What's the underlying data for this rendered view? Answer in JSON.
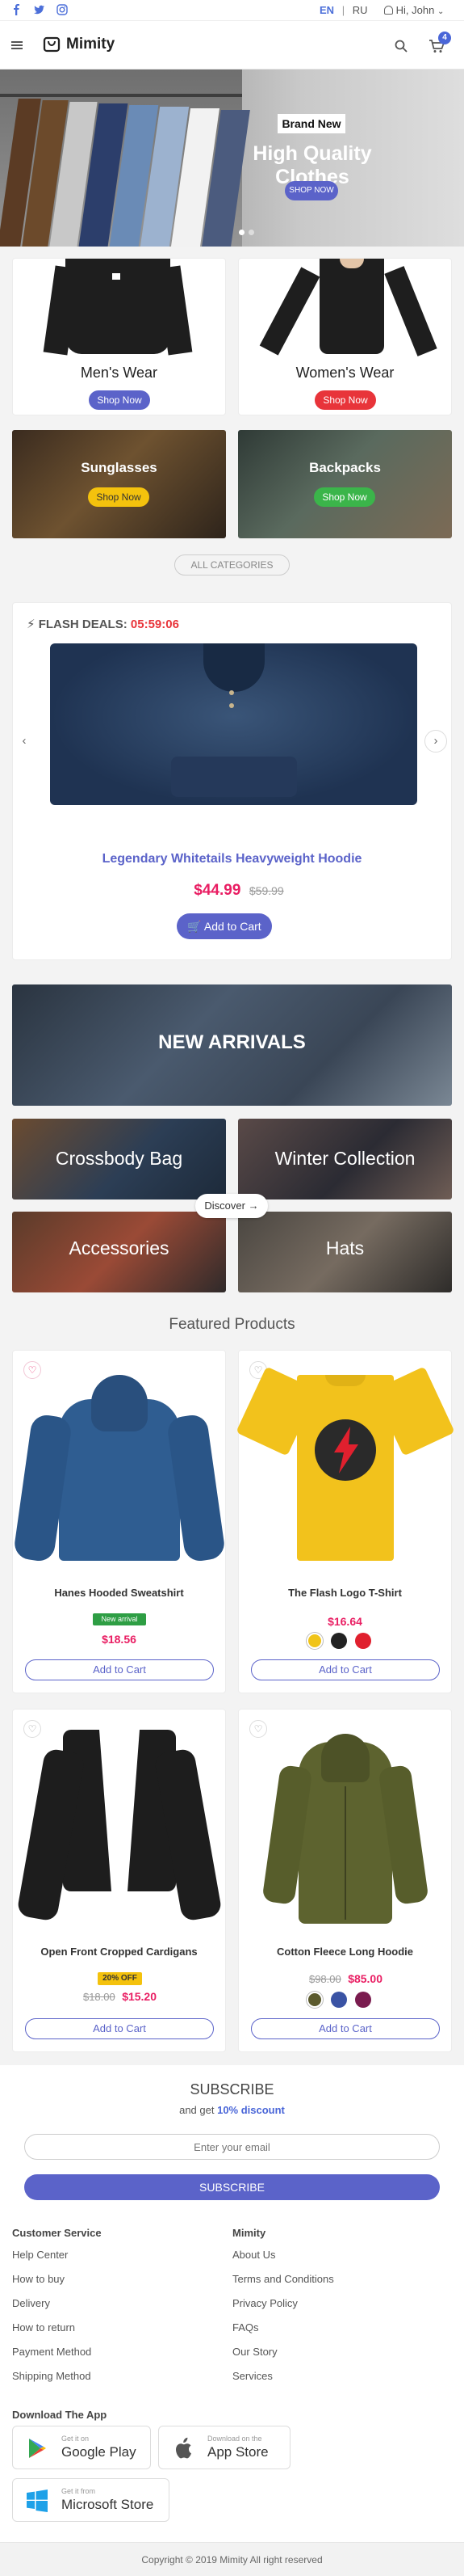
{
  "topbar": {
    "social": [
      "facebook-icon",
      "twitter-icon",
      "instagram-icon"
    ],
    "lang_en": "EN",
    "lang_sep": "|",
    "lang_ru": "RU",
    "greeting": "Hi, John"
  },
  "header": {
    "brand": "Mimity",
    "cart_count": "4"
  },
  "hero": {
    "tag": "Brand New",
    "title": "High Quality Clothes",
    "button": "SHOP NOW"
  },
  "categories": [
    {
      "title": "Men's Wear",
      "button": "Shop Now"
    },
    {
      "title": "Women's Wear",
      "button": "Shop Now"
    },
    {
      "title": "Sunglasses",
      "button": "Shop Now"
    },
    {
      "title": "Backpacks",
      "button": "Shop Now"
    }
  ],
  "all_categories": "ALL CATEGORIES",
  "flash": {
    "label": "FLASH DEALS:",
    "timer": "05:59:06",
    "product": "Legendary Whitetails Heavyweight Hoodie",
    "price": "$44.99",
    "old_price": "$59.99",
    "button": "Add to Cart"
  },
  "collections": {
    "banner": "NEW ARRIVALS",
    "tiles": [
      "Crossbody Bag",
      "Winter Collection",
      "Accessories",
      "Hats"
    ],
    "discover": "Discover"
  },
  "featured": {
    "heading": "Featured Products",
    "products": [
      {
        "name": "Hanes Hooded Sweatshirt",
        "badge": "New arrival",
        "price": "$18.56",
        "old_price": "",
        "button": "Add to Cart",
        "swatches": []
      },
      {
        "name": "The Flash Logo T-Shirt",
        "badge": "",
        "price": "$16.64",
        "old_price": "",
        "button": "Add to Cart",
        "swatches": [
          "#f0c419",
          "#222222",
          "#e0202e"
        ]
      },
      {
        "name": "Open Front Cropped Cardigans",
        "badge": "20% OFF",
        "price": "$15.20",
        "old_price": "$18.00",
        "button": "Add to Cart",
        "swatches": []
      },
      {
        "name": "Cotton Fleece Long Hoodie",
        "badge": "",
        "price": "$85.00",
        "old_price": "$98.00",
        "button": "Add to Cart",
        "swatches": [
          "#5b5a2d",
          "#3a53a4",
          "#7a1c4f"
        ]
      }
    ]
  },
  "subscribe": {
    "title": "SUBSCRIBE",
    "sub_a": "and get",
    "sub_b": "10% discount",
    "placeholder": "Enter your email",
    "button": "SUBSCRIBE"
  },
  "footer": {
    "col1_title": "Customer Service",
    "col1": [
      "Help Center",
      "How to buy",
      "Delivery",
      "How to return",
      "Payment Method",
      "Shipping Method"
    ],
    "col2_title": "Mimity",
    "col2": [
      "About Us",
      "Terms and Conditions",
      "Privacy Policy",
      "FAQs",
      "Our Story",
      "Services"
    ],
    "app_title": "Download The App",
    "stores": [
      {
        "small": "Get it on",
        "big": "Google Play"
      },
      {
        "small": "Download on the",
        "big": "App Store"
      },
      {
        "small": "Get it from",
        "big": "Microsoft Store"
      }
    ],
    "copyright": "Copyright © 2019 Mimity All right reserved"
  },
  "colors": {
    "accent": "#5b63c9",
    "red": "#e8343a",
    "yellow": "#f4c20d",
    "green": "#3bb54a",
    "pink": "#e91e63"
  }
}
